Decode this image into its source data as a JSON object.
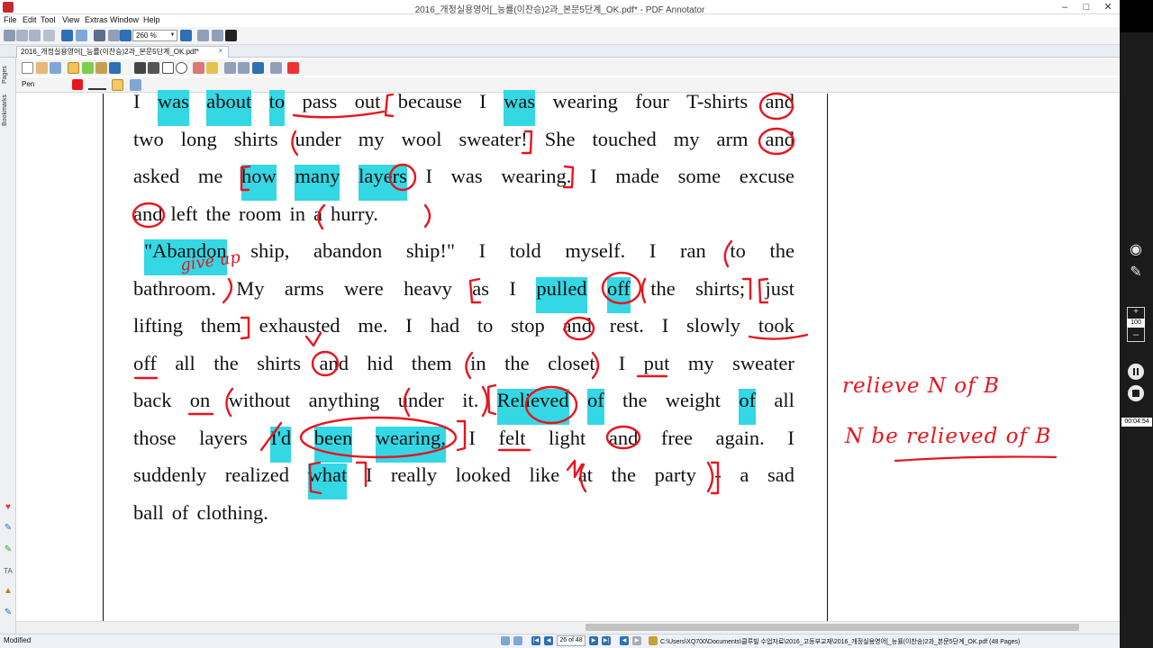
{
  "window": {
    "title": "2016_개정실용영어[_능률(이찬승)2과_본문5단계_OK.pdf* - PDF Annotator",
    "controls": [
      "–",
      "□",
      "✕"
    ]
  },
  "menu": [
    "File",
    "Edit",
    "Tool",
    "View",
    "Extras",
    "Window",
    "Help"
  ],
  "toolbar": {
    "zoom_value": "260 %"
  },
  "tab": {
    "label": "2016_개정실용영어[_능률(이찬승)2과_본문5단계_OK.pdf*",
    "close": "×"
  },
  "pen_toolbar": {
    "label": "Pen"
  },
  "side_tabs": [
    "Pages",
    "Bookmarks"
  ],
  "document": {
    "lines": [
      [
        "I",
        "was",
        "about",
        "to",
        "pass",
        "out",
        "because",
        "I",
        "was",
        "wearing",
        "four",
        "T-shirts",
        "and"
      ],
      [
        "two",
        "long",
        "shirts",
        "under",
        "my",
        "wool",
        "sweater!",
        "She",
        "touched",
        "my",
        "arm",
        "and"
      ],
      [
        "asked",
        "me",
        "how",
        "many",
        "layers",
        "I",
        "was",
        "wearing.",
        "I",
        "made",
        "some",
        "excuse"
      ],
      [
        "and",
        "left",
        "the",
        "room",
        "in",
        "a",
        "hurry."
      ],
      [
        "\"Abandon",
        "ship,",
        "abandon",
        "ship!\"",
        "I",
        "told",
        "myself.",
        "I",
        "ran",
        "to",
        "the"
      ],
      [
        "bathroom.",
        "My",
        "arms",
        "were",
        "heavy",
        "as",
        "I",
        "pulled",
        "off",
        "the",
        "shirts;",
        "just"
      ],
      [
        "lifting",
        "them",
        "exhausted",
        "me.",
        "I",
        "had",
        "to",
        "stop",
        "and",
        "rest.",
        "I",
        "slowly",
        "took"
      ],
      [
        "off",
        "all",
        "the",
        "shirts",
        "and",
        "hid",
        "them",
        "in",
        "the",
        "closet.",
        "I",
        "put",
        "my",
        "sweater"
      ],
      [
        "back",
        "on",
        "without",
        "anything",
        "under",
        "it.",
        "Relieved",
        "of",
        "the",
        "weight",
        "of",
        "all"
      ],
      [
        "those",
        "layers",
        "I'd",
        "been",
        "wearing,",
        "I",
        "felt",
        "light",
        "and",
        "free",
        "again.",
        "I"
      ],
      [
        "suddenly",
        "realized",
        "what",
        "I",
        "really",
        "looked",
        "like",
        "at",
        "the",
        "party",
        "-",
        "a",
        "sad"
      ],
      [
        "ball",
        "of",
        "clothing."
      ]
    ],
    "highlights": {
      "0": [
        "was",
        "about",
        "to"
      ],
      "2": [
        "how",
        "many",
        "layers"
      ],
      "4": [
        "\"Abandon"
      ],
      "5": [
        "pulled",
        "off"
      ],
      "8": [
        "Relieved",
        "of"
      ],
      "9": [
        "I'd",
        "been",
        "wearing,"
      ],
      "10": [
        "what"
      ]
    },
    "highlight_color": "#34d7e4",
    "ink_color": "#e8141e"
  },
  "handwriting": {
    "line1": "relieve N of B",
    "line2": "N be relieved of B",
    "margin_note": "give up"
  },
  "status": {
    "left": "Modified",
    "page": "26 of 48",
    "path": "C:\\Users\\XQ700\\Documents\\클루빌 수업자료\\2016_고등부교재\\2016_개정실용영어[_능률(이찬승)2과_본문5단계_OK.pdf (48 Pages)"
  },
  "recorder": {
    "zoom": "100",
    "zoom_plus": "+",
    "zoom_minus": "–",
    "timer": "00:04:54"
  }
}
